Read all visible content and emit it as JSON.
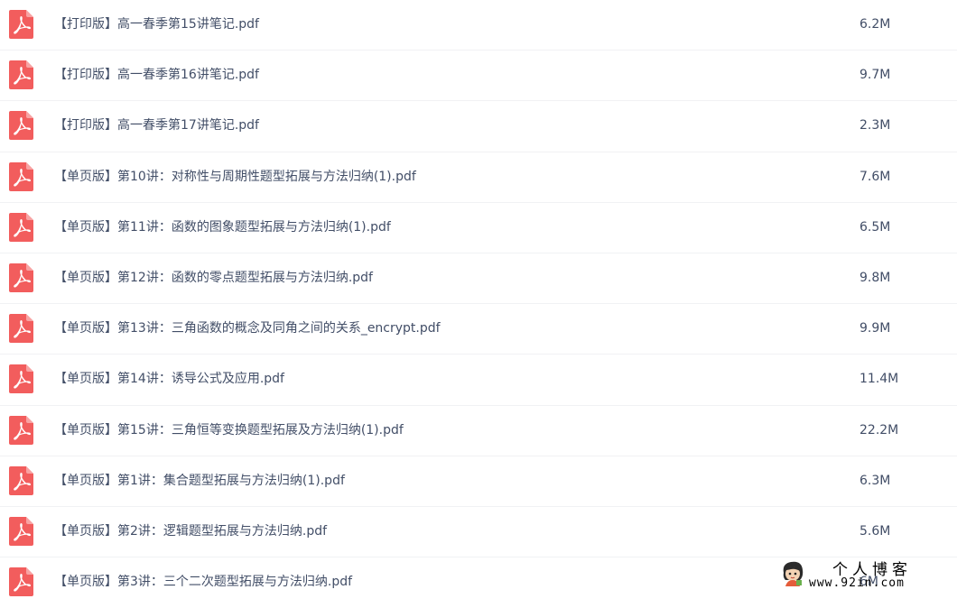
{
  "files": [
    {
      "name": "【打印版】高一春季第15讲笔记.pdf",
      "size": "6.2M",
      "icon": "pdf-file-icon"
    },
    {
      "name": "【打印版】高一春季第16讲笔记.pdf",
      "size": "9.7M",
      "icon": "pdf-file-icon"
    },
    {
      "name": "【打印版】高一春季第17讲笔记.pdf",
      "size": "2.3M",
      "icon": "pdf-file-icon"
    },
    {
      "name": "【单页版】第10讲：对称性与周期性题型拓展与方法归纳(1).pdf",
      "size": "7.6M",
      "icon": "pdf-file-icon"
    },
    {
      "name": "【单页版】第11讲：函数的图象题型拓展与方法归纳(1).pdf",
      "size": "6.5M",
      "icon": "pdf-file-icon"
    },
    {
      "name": "【单页版】第12讲：函数的零点题型拓展与方法归纳.pdf",
      "size": "9.8M",
      "icon": "pdf-file-icon"
    },
    {
      "name": "【单页版】第13讲：三角函数的概念及同角之间的关系_encrypt.pdf",
      "size": "9.9M",
      "icon": "pdf-file-icon"
    },
    {
      "name": "【单页版】第14讲：诱导公式及应用.pdf",
      "size": "11.4M",
      "icon": "pdf-file-icon"
    },
    {
      "name": "【单页版】第15讲：三角恒等变换题型拓展及方法归纳(1).pdf",
      "size": "22.2M",
      "icon": "pdf-file-icon"
    },
    {
      "name": "【单页版】第1讲：集合题型拓展与方法归纳(1).pdf",
      "size": "6.3M",
      "icon": "pdf-file-icon"
    },
    {
      "name": "【单页版】第2讲：逻辑题型拓展与方法归纳.pdf",
      "size": "5.6M",
      "icon": "pdf-file-icon"
    },
    {
      "name": "【单页版】第3讲：三个二次题型拓展与方法归纳.pdf",
      "size": "6M",
      "icon": "pdf-file-icon"
    }
  ],
  "watermark": {
    "title": "个人博客",
    "url": "www.92in.com",
    "icon": "avatar-icon"
  },
  "colors": {
    "pdf_icon": "#f25d5d",
    "text": "#424e67",
    "divider": "#f1f2f4"
  }
}
